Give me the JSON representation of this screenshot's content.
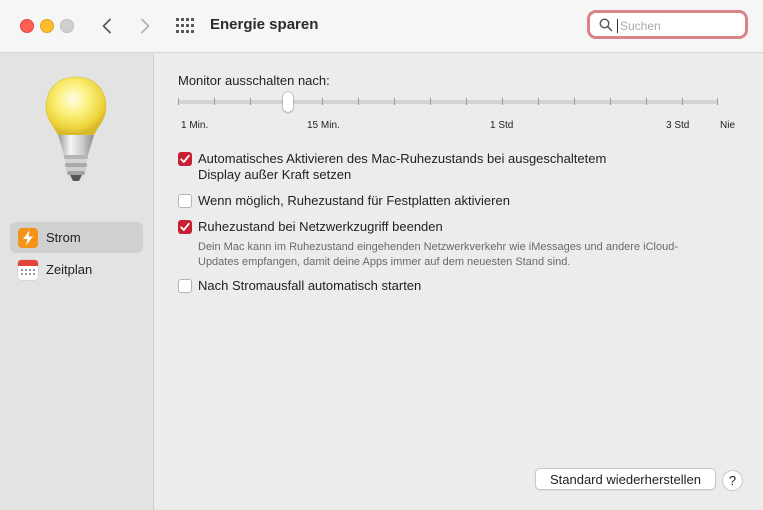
{
  "window": {
    "title": "Energie sparen",
    "search": {
      "placeholder": "Suchen"
    }
  },
  "sidebar": {
    "items": [
      {
        "label": "Strom",
        "selected": true,
        "icon": "lightning-bolt-icon"
      },
      {
        "label": "Zeitplan",
        "selected": false,
        "icon": "calendar-icon"
      }
    ]
  },
  "display_sleep": {
    "label": "Monitor ausschalten nach:",
    "tick_labels": [
      "1 Min.",
      "15 Min.",
      "1 Std",
      "3 Std",
      "Nie"
    ],
    "selected_value": "15 Min."
  },
  "options": [
    {
      "label_line1": "Automatisches Aktivieren des Mac-Ruhezustands bei ausgeschaltetem",
      "label_line2": "Display außer Kraft setzen",
      "checked": true
    },
    {
      "label_line1": "Wenn möglich, Ruhezustand für Festplatten aktivieren",
      "checked": false
    },
    {
      "label_line1": "Ruhezustand bei Netzwerkzugriff beenden",
      "checked": true,
      "hint": "Dein Mac kann im Ruhezustand eingehenden Netzwerkverkehr wie iMessages und andere iCloud-Updates empfangen, damit deine Apps immer auf dem neuesten Stand sind."
    },
    {
      "label_line1": "Nach Stromausfall automatisch starten",
      "checked": false
    }
  ],
  "footer": {
    "reset_label": "Standard wiederherstellen",
    "help_label": "?"
  },
  "colors": {
    "accent": "#c81f35",
    "search_focus_ring": "#d88488"
  }
}
